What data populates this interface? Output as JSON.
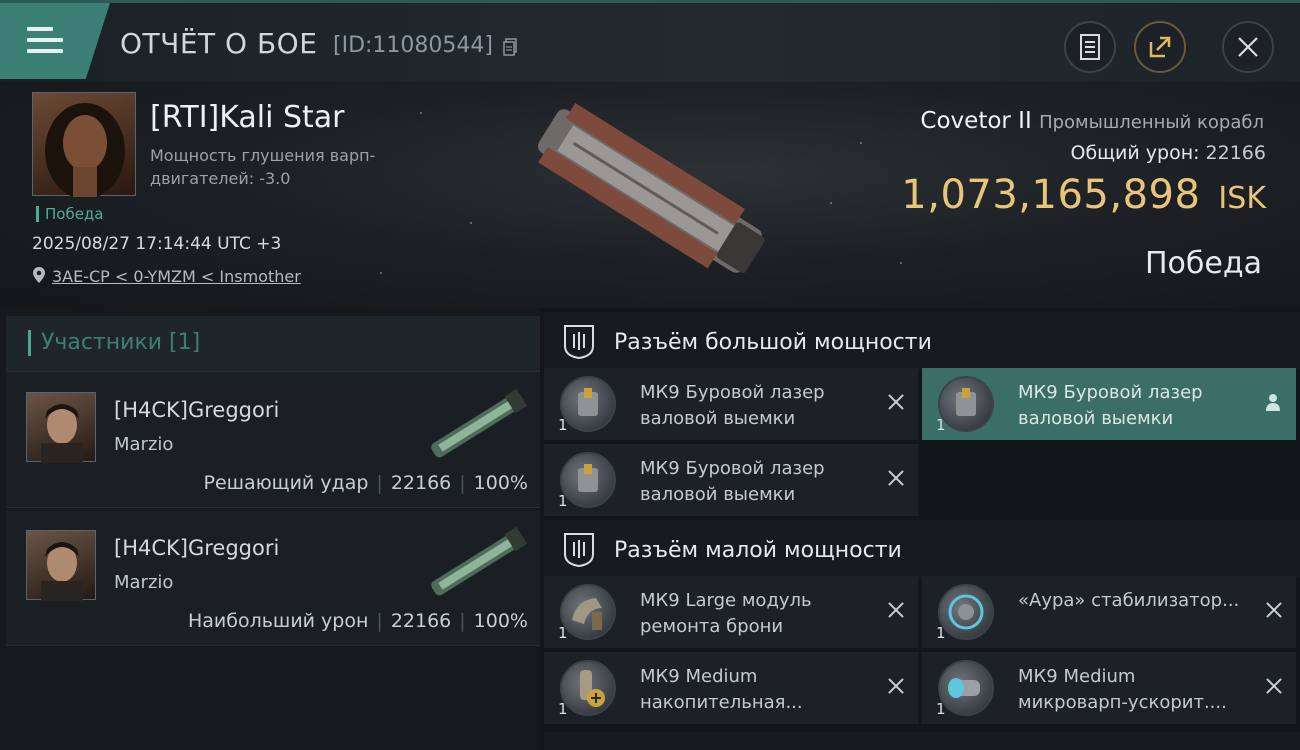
{
  "header": {
    "title": "ОТЧЁТ О БОЕ",
    "report_id": "[ID:11080544]",
    "icons": [
      "menu-icon",
      "copy-icon",
      "document-icon",
      "share-icon",
      "close-icon"
    ]
  },
  "victim": {
    "pilot_name": "[RTI]Kali Star",
    "stat_text": "Мощность глушения варп-двигателей: -3.0",
    "result_tag": "Победа",
    "datetime": "2025/08/27 17:14:44 UTC +3",
    "location": "3AE-CP < 0-YMZM < Insmother",
    "ship_name": "Covetor II",
    "ship_class": "Промышленный корабл",
    "total_damage_label": "Общий урон:",
    "total_damage": "22166",
    "isk_value": "1,073,165,898",
    "isk_unit": "ISK",
    "outcome": "Победа"
  },
  "participants": {
    "tab_label": "Участники [1]",
    "list": [
      {
        "name": "[H4CK]Greggori",
        "corp": "Marzio",
        "role": "Решающий удар",
        "damage": "22166",
        "percent": "100%"
      },
      {
        "name": "[H4CK]Greggori",
        "corp": "Marzio",
        "role": "Наибольший урон",
        "damage": "22166",
        "percent": "100%"
      }
    ]
  },
  "fitting": {
    "high_slot_label": "Разъём большой мощности",
    "low_slot_label": "Разъём малой мощности",
    "high_modules": [
      {
        "qty": "1",
        "name": "МК9 Буровой лазер валовой выемки",
        "icon": "mining-laser-icon",
        "state": "dropped"
      },
      {
        "qty": "1",
        "name": "МК9 Буровой лазер валовой выемки",
        "icon": "mining-laser-icon",
        "state": "selected"
      },
      {
        "qty": "1",
        "name": "МК9 Буровой лазер валовой выемки",
        "icon": "mining-laser-icon",
        "state": "dropped"
      }
    ],
    "low_modules": [
      {
        "qty": "1",
        "name": "МК9 Large модуль ремонта брони",
        "icon": "armor-repairer-icon",
        "state": "dropped"
      },
      {
        "qty": "1",
        "name": "«Аура» стабилизатор...",
        "icon": "stabilizer-icon",
        "state": "dropped"
      },
      {
        "qty": "1",
        "name": "МК9 Medium накопительная...",
        "icon": "capacitor-battery-icon",
        "state": "dropped"
      },
      {
        "qty": "1",
        "name": "МК9 Medium микроварп-ускорит....",
        "icon": "microwarpdrive-icon",
        "state": "dropped"
      }
    ]
  },
  "colors": {
    "accent": "#3c7f76",
    "isk_gold": "#e9c57a",
    "victory_green": "#4fae9b"
  }
}
